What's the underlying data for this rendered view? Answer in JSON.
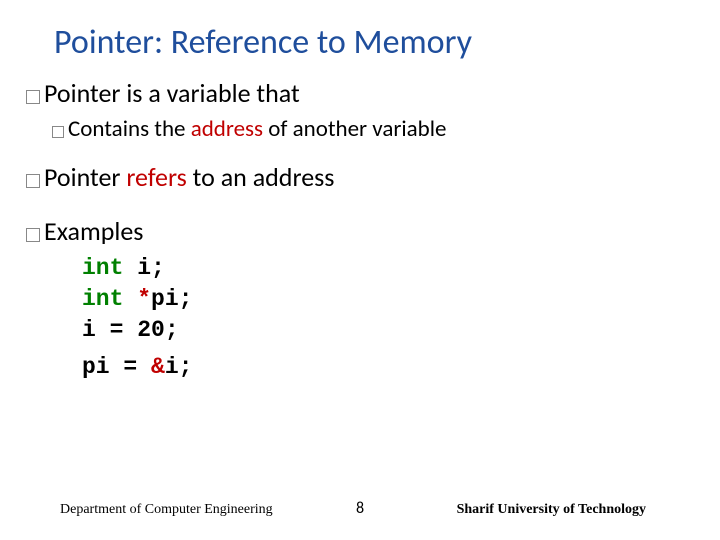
{
  "title": "Pointer: Reference to Memory",
  "bullets": {
    "b1": "Pointer is a variable that",
    "b1_1_pre": "Contains the ",
    "b1_1_red": "address",
    "b1_1_post": " of another variable",
    "b2_pre": "Pointer ",
    "b2_red": "refers",
    "b2_post": " to an address",
    "b3": "Examples"
  },
  "code": {
    "l1_kw": "int",
    "l1_rest": " i;",
    "l2_kw": "int",
    "l2_star": " *",
    "l2_rest": "pi;",
    "l3": "i = 20;",
    "l4_pre": "pi = ",
    "l4_amp": "&",
    "l4_post": "i;"
  },
  "footer": {
    "left": "Department of Computer Engineering",
    "page": "8",
    "right": "Sharif University of Technology"
  }
}
